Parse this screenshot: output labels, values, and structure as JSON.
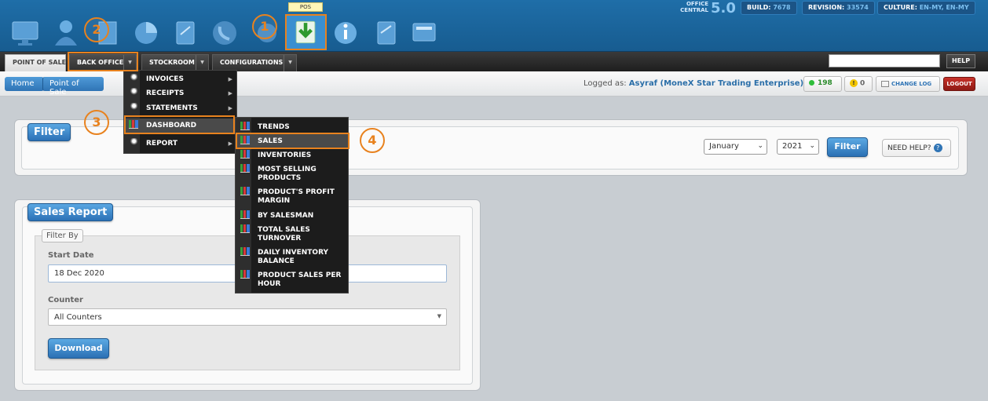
{
  "banner": {
    "pos_tooltip": "POS",
    "office_central_label_1": "OFFICE",
    "office_central_label_2": "CENTRAL",
    "office_central_version": "5.0",
    "build_label": "BUILD:",
    "build_value": "7678",
    "revision_label": "REVISION:",
    "revision_value": "33574",
    "culture_label": "CULTURE:",
    "culture_value": "EN-MY, EN-MY",
    "icons": [
      "monitor-icon",
      "user-icon",
      "document-icon",
      "pie-chart-icon",
      "clipboard-icon",
      "phone-icon",
      "settings-icon",
      "pos-download-icon",
      "info-icon",
      "checklist-icon",
      "system-icon"
    ]
  },
  "nav": {
    "tabs": [
      "POINT OF SALE",
      "BACK OFFICE",
      "STOCKROOM",
      "CONFIGURATIONS"
    ],
    "help_label": "HELP"
  },
  "breadcrumb": {
    "home": "Home",
    "current": "Point of Sale"
  },
  "status": {
    "logged_as_label": "Logged as:",
    "user": "Asyraf (MoneX Star Trading Enterprise)",
    "online_count": "198",
    "warning_count": "0",
    "change_log_label": "CHANGE LOG",
    "logout_label": "LOGOUT"
  },
  "filter_panel": {
    "title": "Filter",
    "month": "January",
    "year": "2021",
    "filter_button": "Filter",
    "need_help": "NEED HELP?"
  },
  "sales_report": {
    "title": "Sales Report",
    "filter_by": "Filter By",
    "start_date_label": "Start Date",
    "start_date_value": "18 Dec 2020",
    "counter_label": "Counter",
    "counter_value": "All Counters",
    "download_button": "Download"
  },
  "back_office_menu": {
    "items": [
      "INVOICES",
      "RECEIPTS",
      "STATEMENTS",
      "DASHBOARD",
      "REPORT"
    ]
  },
  "dashboard_menu": {
    "items": [
      [
        "TRENDS"
      ],
      [
        "SALES"
      ],
      [
        "INVENTORIES"
      ],
      [
        "MOST SELLING",
        "PRODUCTS"
      ],
      [
        "PRODUCT'S PROFIT",
        "MARGIN"
      ],
      [
        "BY SALESMAN"
      ],
      [
        "TOTAL SALES",
        "TURNOVER"
      ],
      [
        "DAILY INVENTORY",
        "BALANCE"
      ],
      [
        "PRODUCT SALES PER",
        "HOUR"
      ]
    ]
  },
  "annotations": [
    "1",
    "2",
    "3",
    "4"
  ],
  "colors": {
    "accent_orange": "#e8821e",
    "brand_blue": "#2f74b5",
    "banner_blue": "#1f6ea8"
  }
}
